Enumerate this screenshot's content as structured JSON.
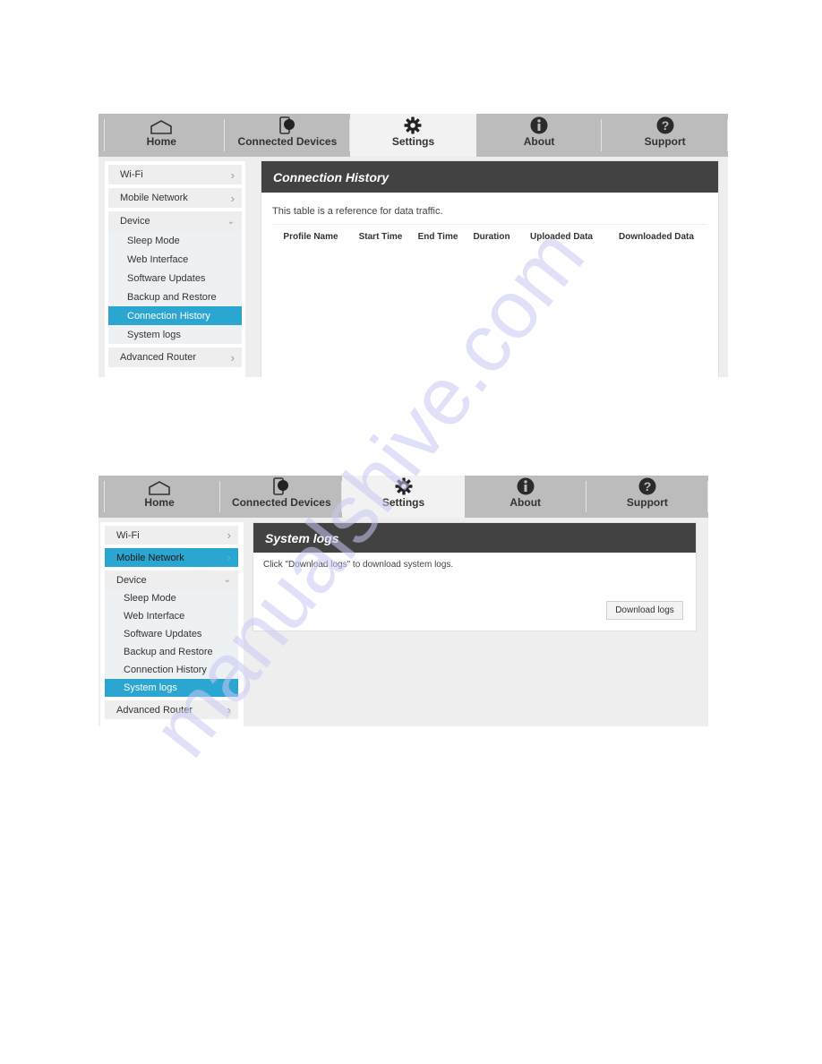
{
  "watermark": "manualshive.com",
  "nav_tabs": [
    {
      "label": "Home",
      "icon": "home-icon"
    },
    {
      "label": "Connected Devices",
      "icon": "connected-devices-icon"
    },
    {
      "label": "Settings",
      "icon": "gear-icon",
      "active": true
    },
    {
      "label": "About",
      "icon": "info-icon"
    },
    {
      "label": "Support",
      "icon": "help-icon"
    }
  ],
  "screen1": {
    "sidebar": {
      "wifi": "Wi-Fi",
      "mobile_network": "Mobile Network",
      "device": "Device",
      "device_items": [
        "Sleep Mode",
        "Web Interface",
        "Software Updates",
        "Backup and Restore",
        "Connection History",
        "System logs"
      ],
      "selected_item": "Connection History",
      "advanced_router": "Advanced Router"
    },
    "panel": {
      "title": "Connection History",
      "description": "This table is a reference for data traffic.",
      "columns": [
        "Profile Name",
        "Start Time",
        "End Time",
        "Duration",
        "Uploaded Data",
        "Downloaded Data"
      ],
      "rows": []
    }
  },
  "screen2": {
    "sidebar": {
      "wifi": "Wi-Fi",
      "mobile_network": "Mobile Network",
      "device": "Device",
      "device_items": [
        "Sleep Mode",
        "Web Interface",
        "Software Updates",
        "Backup and Restore",
        "Connection History",
        "System logs"
      ],
      "selected_item": "System logs",
      "advanced_router": "Advanced Router"
    },
    "panel": {
      "title": "System logs",
      "description": "Click \"Download logs\" to download system logs.",
      "download_button": "Download logs"
    }
  },
  "colors": {
    "accent": "#2aa6d1",
    "header_dark": "#424242",
    "nav_bg": "#bcbcbc"
  }
}
